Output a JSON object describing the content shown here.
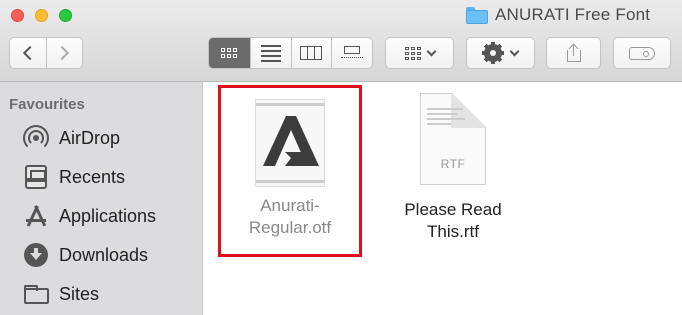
{
  "window": {
    "title": "ANURATI Free Font"
  },
  "sidebar": {
    "heading": "Favourites",
    "items": [
      {
        "label": "AirDrop",
        "icon": "airdrop-icon"
      },
      {
        "label": "Recents",
        "icon": "recents-icon"
      },
      {
        "label": "Applications",
        "icon": "applications-icon"
      },
      {
        "label": "Downloads",
        "icon": "downloads-icon"
      },
      {
        "label": "Sites",
        "icon": "folder-icon"
      }
    ]
  },
  "files": [
    {
      "name": "Anurati-Regular.otf",
      "name_line1": "Anurati-",
      "name_line2": "Regular.otf",
      "selected": true
    },
    {
      "name": "Please Read This.rtf",
      "name_line1": "Please Read",
      "name_line2": "This.rtf",
      "icon_ext": "RTF"
    }
  ],
  "colors": {
    "highlight_border": "#e01020",
    "sidebar_bg": "#dcdbdd"
  }
}
